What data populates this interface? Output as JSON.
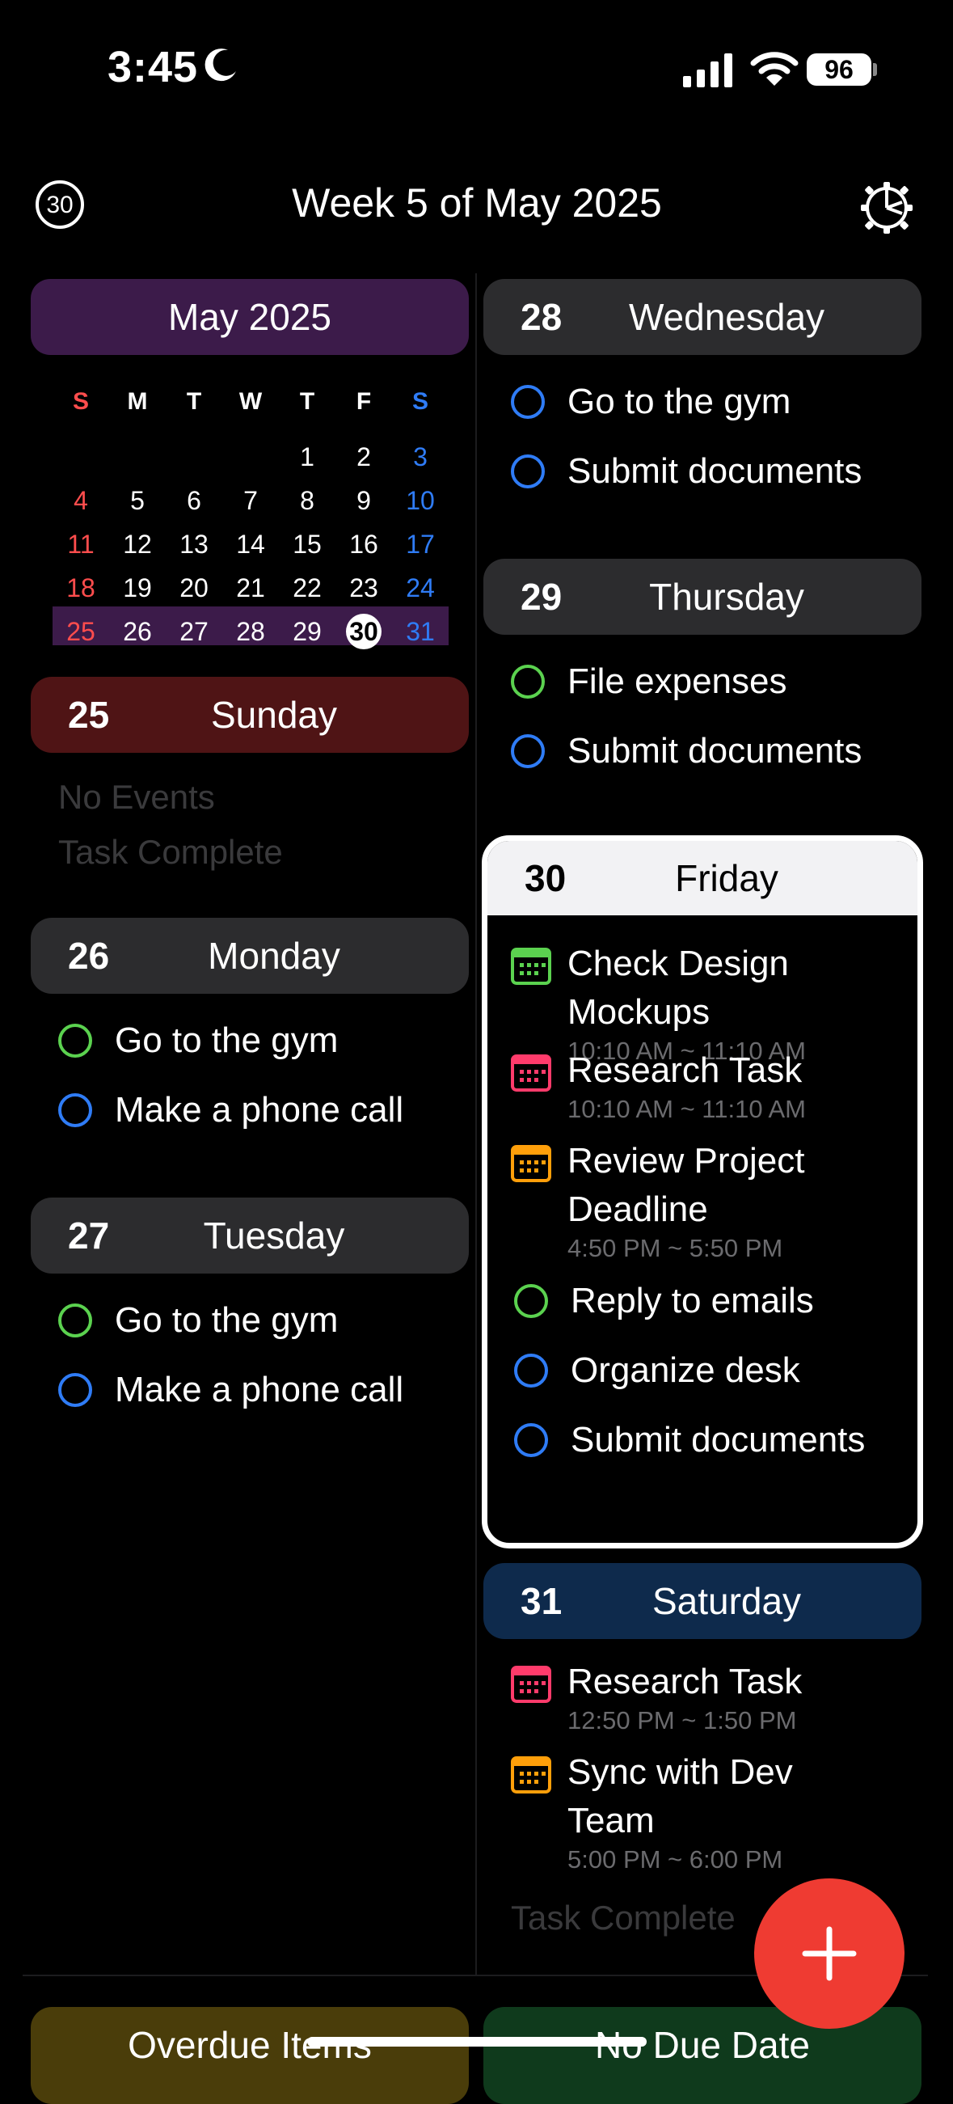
{
  "status_bar": {
    "time": "3:45",
    "battery": "96"
  },
  "header": {
    "badge": "30",
    "title": "Week 5 of May 2025"
  },
  "mini_calendar": {
    "month_label": "May 2025",
    "weekday_headers": [
      "S",
      "M",
      "T",
      "W",
      "T",
      "F",
      "S"
    ],
    "weeks": [
      [
        "",
        "",
        "",
        "",
        "1",
        "2",
        "3"
      ],
      [
        "4",
        "5",
        "6",
        "7",
        "8",
        "9",
        "10"
      ],
      [
        "11",
        "12",
        "13",
        "14",
        "15",
        "16",
        "17"
      ],
      [
        "18",
        "19",
        "20",
        "21",
        "22",
        "23",
        "24"
      ],
      [
        "25",
        "26",
        "27",
        "28",
        "29",
        "30",
        "31"
      ]
    ],
    "today": "30"
  },
  "days": {
    "sun": {
      "num": "25",
      "name": "Sunday",
      "empty1": "No Events",
      "empty2": "Task Complete"
    },
    "mon": {
      "num": "26",
      "name": "Monday",
      "tasks": [
        "Go to the gym",
        "Make a phone call"
      ]
    },
    "tue": {
      "num": "27",
      "name": "Tuesday",
      "tasks": [
        "Go to the gym",
        "Make a phone call"
      ]
    },
    "wed": {
      "num": "28",
      "name": "Wednesday",
      "tasks": [
        "Go to the gym",
        "Submit documents"
      ]
    },
    "thu": {
      "num": "29",
      "name": "Thursday",
      "tasks": [
        "File expenses",
        "Submit documents"
      ]
    },
    "fri": {
      "num": "30",
      "name": "Friday",
      "events": [
        {
          "title_l1": "Check Design",
          "title_l2": "Mockups",
          "time": "10:10 AM ~ 11:10 AM"
        },
        {
          "title_l1": "Research Task",
          "time": "10:10 AM ~ 11:10 AM"
        },
        {
          "title_l1": "Review Project",
          "title_l2": "Deadline",
          "time": "4:50 PM ~ 5:50 PM"
        }
      ],
      "tasks": [
        "Reply to emails",
        "Organize desk",
        "Submit documents"
      ]
    },
    "sat": {
      "num": "31",
      "name": "Saturday",
      "events": [
        {
          "title_l1": "Research Task",
          "time": "12:50 PM ~ 1:50 PM"
        },
        {
          "title_l1": "Sync with Dev",
          "title_l2": "Team",
          "time": "5:00 PM ~ 6:00 PM"
        }
      ],
      "footer": "Task Complete"
    }
  },
  "bottom": {
    "left": "Overdue Items",
    "right": "No Due Date"
  },
  "colors": {
    "accent_purple": "#3c1b4a",
    "sunday_red": "#4f1415",
    "saturday_blue": "#0e2a4c",
    "fab_red": "#ef3b32",
    "green_event": "#5bd24f",
    "pink_event": "#ff3b6b",
    "orange_event": "#ff9f0a"
  }
}
